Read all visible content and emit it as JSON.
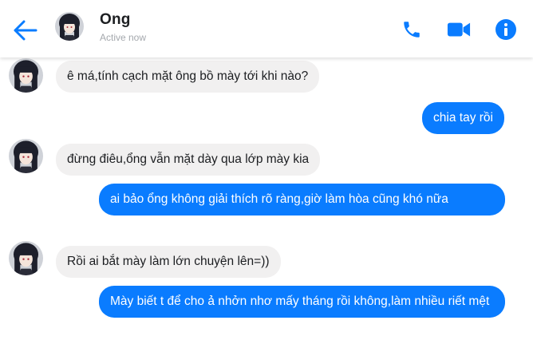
{
  "header": {
    "contact_name": "Ong",
    "status": "Active now",
    "icons": {
      "back": "back-arrow-icon",
      "phone": "phone-icon",
      "video": "video-camera-icon",
      "info": "info-icon"
    }
  },
  "messages": [
    {
      "direction": "in",
      "text": "ê má,tính cạch mặt ông bồ mày tới khi nào?"
    },
    {
      "direction": "out",
      "text": "chia tay rồi"
    },
    {
      "direction": "in",
      "text": "đừng điêu,ổng vẫn mặt dày qua lớp mày kia"
    },
    {
      "direction": "out",
      "text": "ai bảo ổng không giải thích rõ ràng,giờ làm hòa cũng khó nữa"
    },
    {
      "direction": "in",
      "text": "Rồi ai bắt mày làm lớn chuyện lên=))"
    },
    {
      "direction": "out",
      "text": "Mày biết t để cho ả nhởn nhơ mấy tháng rồi không,làm nhiều riết mệt"
    }
  ],
  "colors": {
    "accent": "#0a7cff",
    "incoming_bubble": "#f1f0f0",
    "status_text": "#a4a8ad"
  }
}
